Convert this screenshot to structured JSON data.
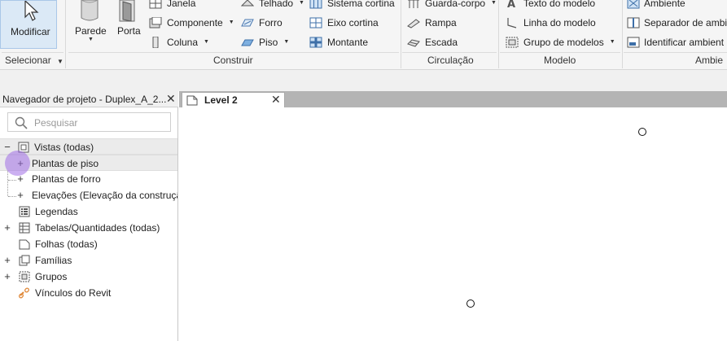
{
  "ribbon": {
    "select_panel": {
      "modify_label": "Modificar",
      "panel_label": "Selecionar"
    },
    "build_panel": {
      "panel_label": "Construir",
      "wall_label": "Parede",
      "door_label": "Porta",
      "window_label": "Janela",
      "component_label": "Componente",
      "column_label": "Coluna",
      "roof_label": "Telhado",
      "ceiling_label": "Forro",
      "floor_label": "Piso",
      "curtain_system_label": "Sistema cortina",
      "curtain_grid_label": "Eixo cortina",
      "mullion_label": "Montante"
    },
    "circulation_panel": {
      "panel_label": "Circulação",
      "railing_label": "Guarda-corpo",
      "ramp_label": "Rampa",
      "stair_label": "Escada"
    },
    "model_panel": {
      "panel_label": "Modelo",
      "model_text_label": "Texto do modelo",
      "model_line_label": "Linha do modelo",
      "model_group_label": "Grupo de modelos"
    },
    "room_panel": {
      "panel_label": "Ambie",
      "room_label": "Ambiente",
      "room_separator_label": "Separador de ambi",
      "room_tag_label": "Identificar ambient"
    }
  },
  "project_browser": {
    "title": "Navegador de projeto - Duplex_A_2...",
    "search_placeholder": "Pesquisar",
    "tree": [
      {
        "expander": "−",
        "label": "Vistas (todas)",
        "icon": "views-icon"
      },
      {
        "expander": "+",
        "label": "Plantas de piso"
      },
      {
        "expander": "+",
        "label": "Plantas de forro"
      },
      {
        "expander": "+",
        "label": "Elevações (Elevação da construção"
      },
      {
        "expander": "",
        "label": "Legendas",
        "icon": "legend-icon"
      },
      {
        "expander": "+",
        "label": "Tabelas/Quantidades (todas)",
        "icon": "schedule-icon"
      },
      {
        "expander": "",
        "label": "Folhas (todas)",
        "icon": "sheet-icon"
      },
      {
        "expander": "+",
        "label": "Famílias",
        "icon": "families-icon"
      },
      {
        "expander": "+",
        "label": "Grupos",
        "icon": "groups-icon"
      },
      {
        "expander": "",
        "label": "Vínculos do Revit",
        "icon": "link-icon"
      }
    ]
  },
  "view": {
    "tab_label": "Level 2"
  }
}
